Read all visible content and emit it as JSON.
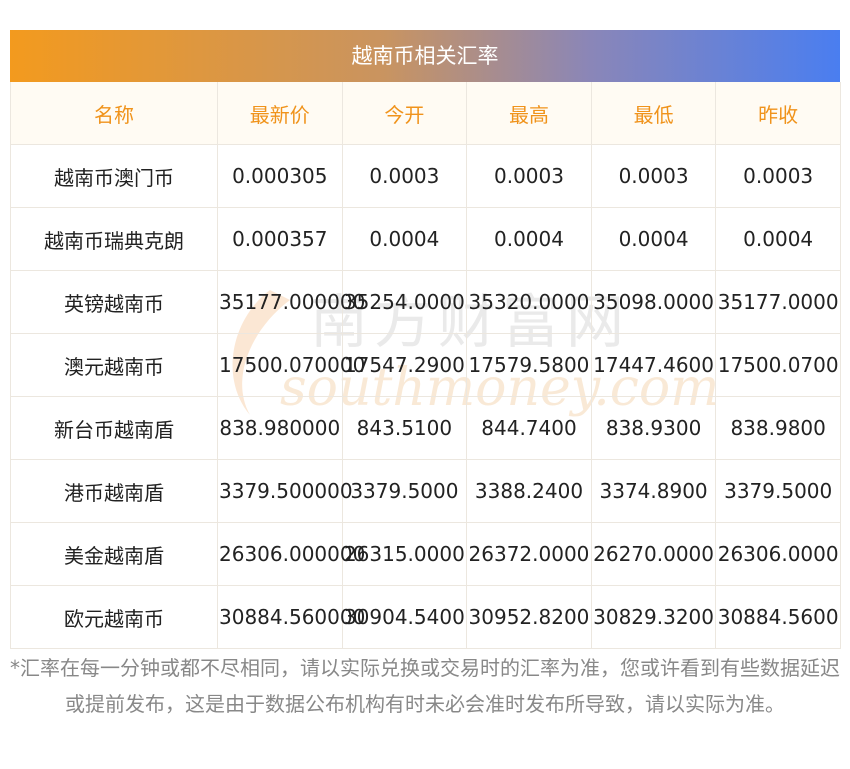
{
  "title": "越南币相关汇率",
  "watermark": {
    "cn": "南方财富网",
    "en": "southmoney.com"
  },
  "table": {
    "headers": [
      "名称",
      "最新价",
      "今开",
      "最高",
      "最低",
      "昨收"
    ],
    "rows": [
      [
        "越南币澳门币",
        "0.000305",
        "0.0003",
        "0.0003",
        "0.0003",
        "0.0003"
      ],
      [
        "越南币瑞典克朗",
        "0.000357",
        "0.0004",
        "0.0004",
        "0.0004",
        "0.0004"
      ],
      [
        "英镑越南币",
        "35177.000000",
        "35254.0000",
        "35320.0000",
        "35098.0000",
        "35177.0000"
      ],
      [
        "澳元越南币",
        "17500.070000",
        "17547.2900",
        "17579.5800",
        "17447.4600",
        "17500.0700"
      ],
      [
        "新台币越南盾",
        "838.980000",
        "843.5100",
        "844.7400",
        "838.9300",
        "838.9800"
      ],
      [
        "港币越南盾",
        "3379.500000",
        "3379.5000",
        "3388.2400",
        "3374.8900",
        "3379.5000"
      ],
      [
        "美金越南盾",
        "26306.000000",
        "26315.0000",
        "26372.0000",
        "26270.0000",
        "26306.0000"
      ],
      [
        "欧元越南币",
        "30884.560000",
        "30904.5400",
        "30952.8200",
        "30829.3200",
        "30884.5600"
      ]
    ]
  },
  "footnote": "*汇率在每一分钟或都不尽相同，请以实际兑换或交易时的汇率为准，您或许看到有些数据延迟或提前发布，这是由于数据公布机构有时未必会准时发布所导致，请以实际为准。",
  "colors": {
    "header_text": "#f0931b",
    "header_bg": "#fffbf3",
    "gradient_start": "#f39a1e",
    "gradient_end": "#4a7ef0"
  }
}
